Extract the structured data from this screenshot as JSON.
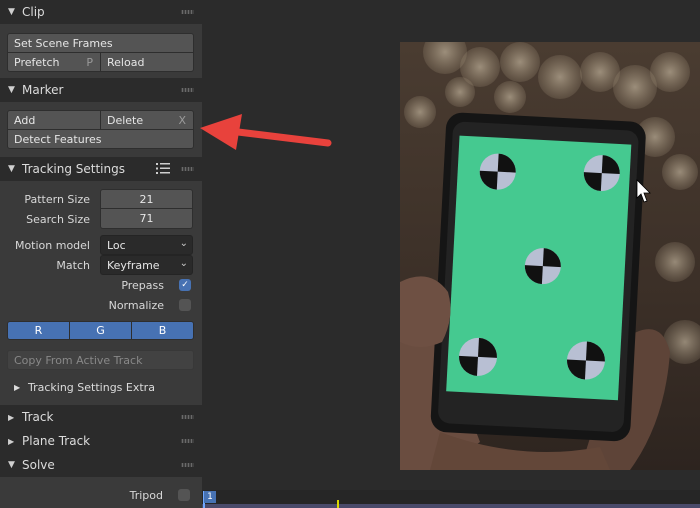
{
  "sidebar": {
    "clip": {
      "title": "Clip",
      "set_scene_frames": "Set Scene Frames",
      "prefetch": "Prefetch",
      "prefetch_key": "P",
      "reload": "Reload"
    },
    "marker": {
      "title": "Marker",
      "add": "Add",
      "delete": "Delete",
      "delete_key": "X",
      "detect_features": "Detect Features"
    },
    "tracking_settings": {
      "title": "Tracking Settings",
      "pattern_size_label": "Pattern Size",
      "pattern_size": "21",
      "search_size_label": "Search Size",
      "search_size": "71",
      "motion_model_label": "Motion model",
      "motion_model": "Loc",
      "match_label": "Match",
      "match": "Keyframe",
      "prepass_label": "Prepass",
      "prepass_checked": true,
      "normalize_label": "Normalize",
      "normalize_checked": false,
      "channel_r": "R",
      "channel_g": "G",
      "channel_b": "B",
      "copy_from_active": "Copy From Active Track",
      "extra_title": "Tracking Settings Extra"
    },
    "track": {
      "title": "Track"
    },
    "plane_track": {
      "title": "Plane Track"
    },
    "solve": {
      "title": "Solve",
      "tripod_label": "Tripod",
      "tripod_checked": false
    }
  },
  "timeline": {
    "current_frame": "1"
  },
  "annotation": {
    "arrow_color": "#e8423c"
  },
  "colors": {
    "accent": "#4772b3",
    "screen_green": "#45c990"
  }
}
